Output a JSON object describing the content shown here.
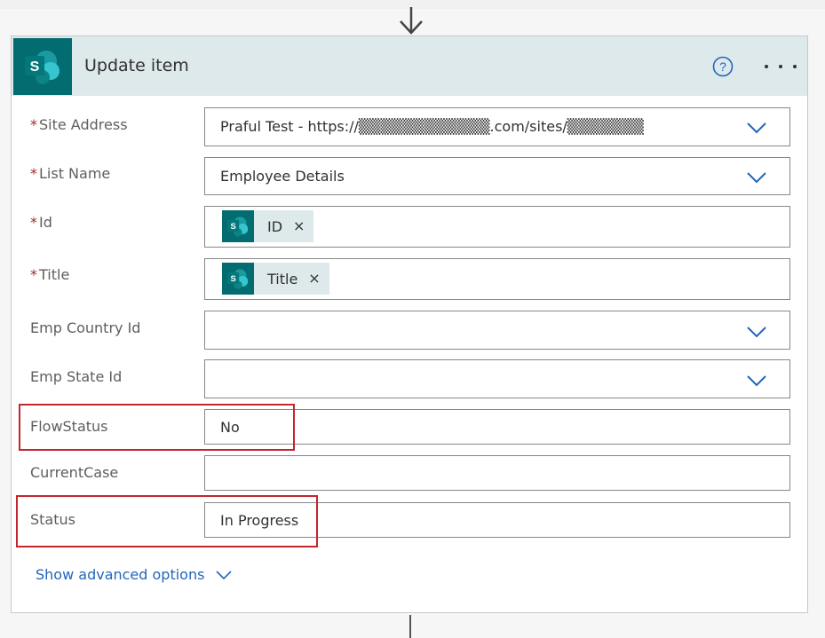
{
  "card": {
    "title": "Update item",
    "app_icon": "sharepoint-icon",
    "logo_letter": "S",
    "accent_color": "#036c70",
    "header_color": "#dde9eb",
    "help_icon": "help-circle-icon",
    "more_icon": "more-options-icon"
  },
  "fields": {
    "site_address": {
      "label": "Site Address",
      "required_mark": "*",
      "value": "Praful Test - https://▒▒▒▒▒▒▒▒▒▒▒▒.com/sites/▒▒▒▒▒▒▒"
    },
    "list_name": {
      "label": "List Name",
      "required_mark": "*",
      "value": "Employee Details"
    },
    "id": {
      "label": "Id",
      "required_mark": "*",
      "token_label": "ID",
      "token_close": "×"
    },
    "title": {
      "label": "Title",
      "required_mark": "*",
      "token_label": "Title",
      "token_close": "×"
    },
    "emp_country_id": {
      "label": "Emp Country Id",
      "value": ""
    },
    "emp_state_id": {
      "label": "Emp State Id",
      "value": ""
    },
    "flow_status": {
      "label": "FlowStatus",
      "value": "No"
    },
    "current_case": {
      "label": "CurrentCase",
      "value": ""
    },
    "status": {
      "label": "Status",
      "value": "In Progress"
    }
  },
  "advanced": {
    "label": "Show advanced options"
  },
  "highlight_color": "#c4262e",
  "link_color": "#2266bb"
}
